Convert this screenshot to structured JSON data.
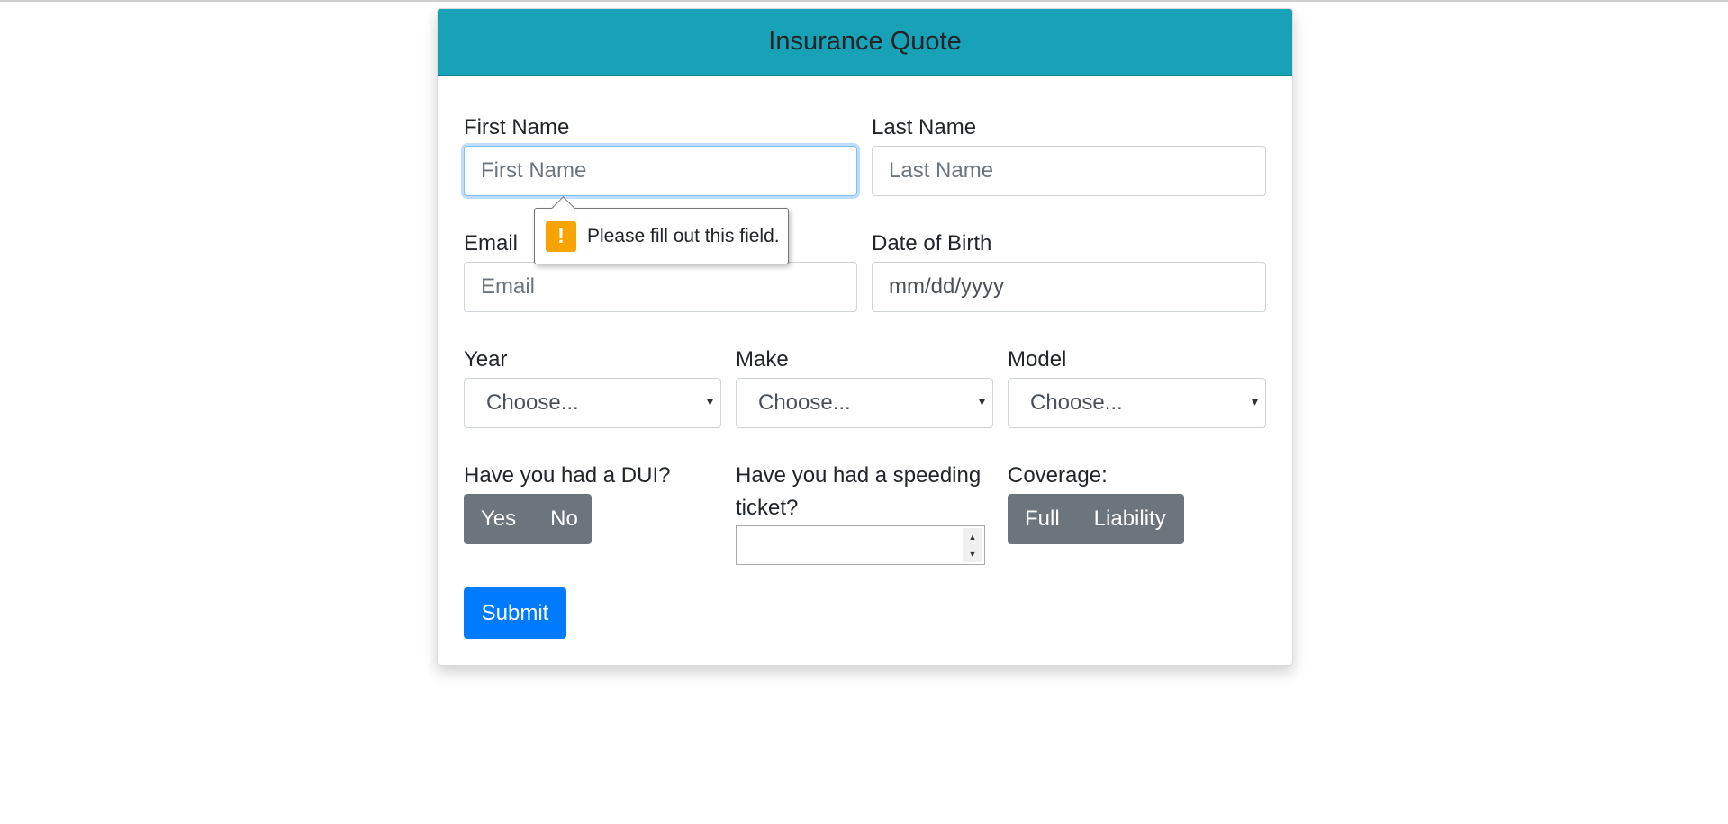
{
  "form": {
    "title": "Insurance Quote",
    "first_name": {
      "label": "First Name",
      "placeholder": "First Name",
      "value": ""
    },
    "last_name": {
      "label": "Last Name",
      "placeholder": "Last Name",
      "value": ""
    },
    "email": {
      "label": "Email",
      "placeholder": "Email",
      "value": ""
    },
    "dob": {
      "label": "Date of Birth",
      "value": "mm/dd/yyyy"
    },
    "year": {
      "label": "Year",
      "selected": "Choose..."
    },
    "make": {
      "label": "Make",
      "selected": "Choose..."
    },
    "model": {
      "label": "Model",
      "selected": "Choose..."
    },
    "dui": {
      "label": "Have you had a DUI?",
      "options": [
        "Yes",
        "No"
      ]
    },
    "speeding": {
      "label_line1": "Have you had a speeding",
      "label_line2": "ticket?",
      "value": ""
    },
    "coverage": {
      "label": "Coverage:",
      "options": [
        "Full",
        "Liability"
      ]
    },
    "submit_label": "Submit"
  },
  "validation_tooltip": {
    "icon": "warning-icon",
    "icon_glyph": "!",
    "message": "Please fill out this field."
  },
  "colors": {
    "header_bg": "#17a2b8",
    "primary": "#007bff",
    "secondary": "#6c757d",
    "warning": "#f7a400"
  },
  "icons": {
    "select_caret": "▾",
    "spin_up": "▲",
    "spin_down": "▼"
  }
}
